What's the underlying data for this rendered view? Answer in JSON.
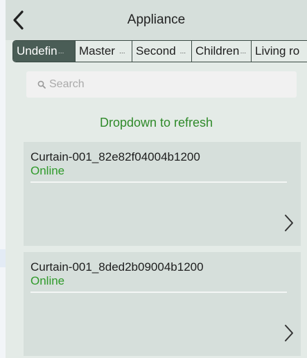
{
  "header": {
    "title": "Appliance",
    "back_icon": "chevron-left-icon"
  },
  "tabs": [
    {
      "label": "Undefin",
      "active": true
    },
    {
      "label": "Master",
      "active": false
    },
    {
      "label": "Second",
      "active": false
    },
    {
      "label": "Children",
      "active": false
    },
    {
      "label": "Living ro",
      "active": false
    }
  ],
  "search": {
    "placeholder": "Search",
    "value": "",
    "icon": "search-icon"
  },
  "refresh_hint": "Dropdown to refresh",
  "devices": [
    {
      "name": "Curtain-001_82e82f04004b1200",
      "status": "Online",
      "chevron_icon": "chevron-right-icon"
    },
    {
      "name": "Curtain-001_8ded2b09004b1200",
      "status": "Online",
      "chevron_icon": "chevron-right-icon"
    }
  ],
  "colors": {
    "background": "#e4ebe7",
    "header": "#d6dfdb",
    "active_tab": "#4a5d56",
    "online_text": "#2f9a2a",
    "refresh_text": "#2f8a2a"
  }
}
